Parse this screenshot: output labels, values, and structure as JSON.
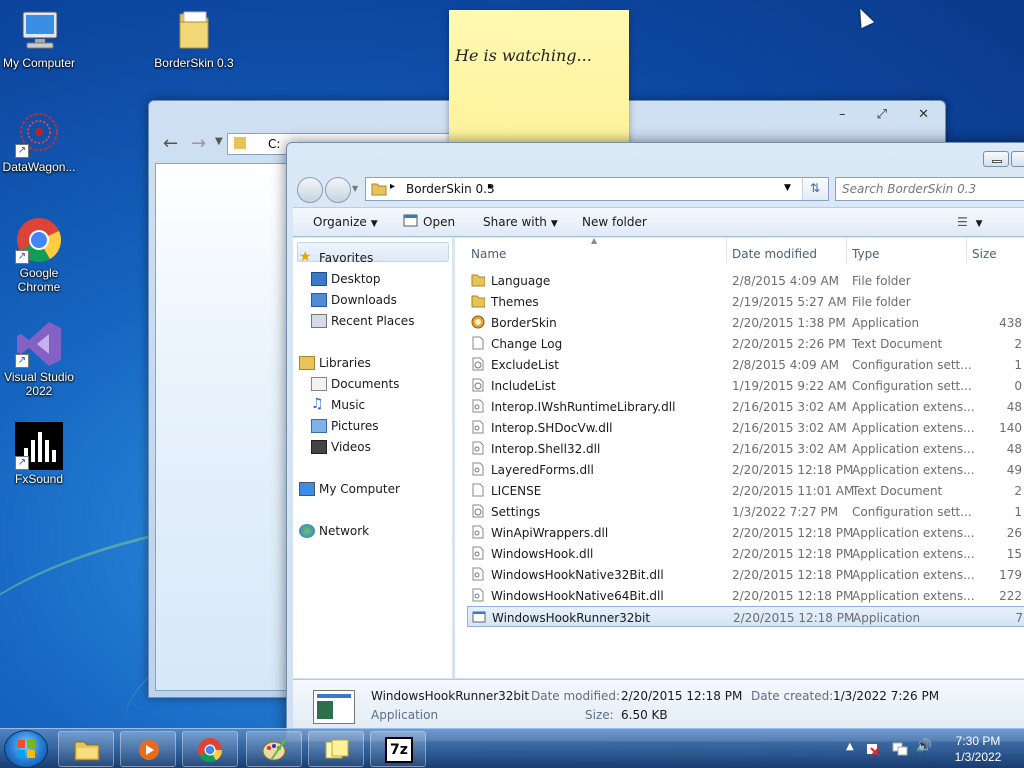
{
  "desktop": {
    "icons": [
      {
        "label": "My Computer",
        "icon": "computer-icon"
      },
      {
        "label": "BorderSkin 0.3",
        "icon": "folder-icon"
      },
      {
        "label": "DataWagon...",
        "icon": "datawagon-icon"
      },
      {
        "label": "Google Chrome",
        "icon": "chrome-icon"
      },
      {
        "label": "Visual Studio 2022",
        "icon": "visual-studio-icon"
      },
      {
        "label": "FxSound",
        "icon": "fxsound-icon"
      }
    ]
  },
  "sticky_note": {
    "text": "He is watching..."
  },
  "back_window": {
    "address": "C:"
  },
  "explorer": {
    "address": {
      "path": "BorderSkin 0.3"
    },
    "search": {
      "placeholder": "Search BorderSkin 0.3"
    },
    "toolbar": {
      "organize": "Organize",
      "open": "Open",
      "share_with": "Share with",
      "new_folder": "New folder"
    },
    "nav": {
      "favorites": "Favorites",
      "desktop": "Desktop",
      "downloads": "Downloads",
      "recent_places": "Recent Places",
      "libraries": "Libraries",
      "documents": "Documents",
      "music": "Music",
      "pictures": "Pictures",
      "videos": "Videos",
      "my_computer": "My Computer",
      "network": "Network"
    },
    "columns": {
      "name": "Name",
      "date": "Date modified",
      "type": "Type",
      "size": "Size"
    },
    "files": [
      {
        "name": "Language",
        "date": "2/8/2015 4:09 AM",
        "type": "File folder",
        "size": "",
        "icon": "folder-icon"
      },
      {
        "name": "Themes",
        "date": "2/19/2015 5:27 AM",
        "type": "File folder",
        "size": "",
        "icon": "folder-icon"
      },
      {
        "name": "BorderSkin",
        "date": "2/20/2015 1:38 PM",
        "type": "Application",
        "size": "438",
        "icon": "app-icon"
      },
      {
        "name": "Change Log",
        "date": "2/20/2015 2:26 PM",
        "type": "Text Document",
        "size": "2",
        "icon": "text-file-icon"
      },
      {
        "name": "ExcludeList",
        "date": "2/8/2015 4:09 AM",
        "type": "Configuration sett...",
        "size": "1",
        "icon": "config-file-icon"
      },
      {
        "name": "IncludeList",
        "date": "1/19/2015 9:22 AM",
        "type": "Configuration sett...",
        "size": "0",
        "icon": "config-file-icon"
      },
      {
        "name": "Interop.IWshRuntimeLibrary.dll",
        "date": "2/16/2015 3:02 AM",
        "type": "Application extens...",
        "size": "48",
        "icon": "dll-file-icon"
      },
      {
        "name": "Interop.SHDocVw.dll",
        "date": "2/16/2015 3:02 AM",
        "type": "Application extens...",
        "size": "140",
        "icon": "dll-file-icon"
      },
      {
        "name": "Interop.Shell32.dll",
        "date": "2/16/2015 3:02 AM",
        "type": "Application extens...",
        "size": "48",
        "icon": "dll-file-icon"
      },
      {
        "name": "LayeredForms.dll",
        "date": "2/20/2015 12:18 PM",
        "type": "Application extens...",
        "size": "49",
        "icon": "dll-file-icon"
      },
      {
        "name": "LICENSE",
        "date": "2/20/2015 11:01 AM",
        "type": "Text Document",
        "size": "2",
        "icon": "text-file-icon"
      },
      {
        "name": "Settings",
        "date": "1/3/2022 7:27 PM",
        "type": "Configuration sett...",
        "size": "1",
        "icon": "config-file-icon"
      },
      {
        "name": "WinApiWrappers.dll",
        "date": "2/20/2015 12:18 PM",
        "type": "Application extens...",
        "size": "26",
        "icon": "dll-file-icon"
      },
      {
        "name": "WindowsHook.dll",
        "date": "2/20/2015 12:18 PM",
        "type": "Application extens...",
        "size": "15",
        "icon": "dll-file-icon"
      },
      {
        "name": "WindowsHookNative32Bit.dll",
        "date": "2/20/2015 12:18 PM",
        "type": "Application extens...",
        "size": "179",
        "icon": "dll-file-icon"
      },
      {
        "name": "WindowsHookNative64Bit.dll",
        "date": "2/20/2015 12:18 PM",
        "type": "Application extens...",
        "size": "222",
        "icon": "dll-file-icon"
      },
      {
        "name": "WindowsHookRunner32bit",
        "date": "2/20/2015 12:18 PM",
        "type": "Application",
        "size": "7",
        "icon": "app-window-icon",
        "selected": true
      }
    ],
    "details": {
      "name": "WindowsHookRunner32bit",
      "type": "Application",
      "modified_label": "Date modified:",
      "modified": "2/20/2015 12:18 PM",
      "created_label": "Date created:",
      "created": "1/3/2022 7:26 PM",
      "size_label": "Size:",
      "size": "6.50 KB"
    }
  },
  "taskbar": {
    "time": "7:30 PM",
    "date": "1/3/2022",
    "buttons": [
      "explorer-icon",
      "media-player-icon",
      "chrome-icon",
      "paint-icon",
      "sticky-notes-icon",
      "7zip-icon"
    ],
    "sevenzip_label": "7z"
  },
  "colors": {
    "accent": "#3a78c9",
    "selection": "#d3e4f6",
    "sticky": "#fff9b1"
  }
}
